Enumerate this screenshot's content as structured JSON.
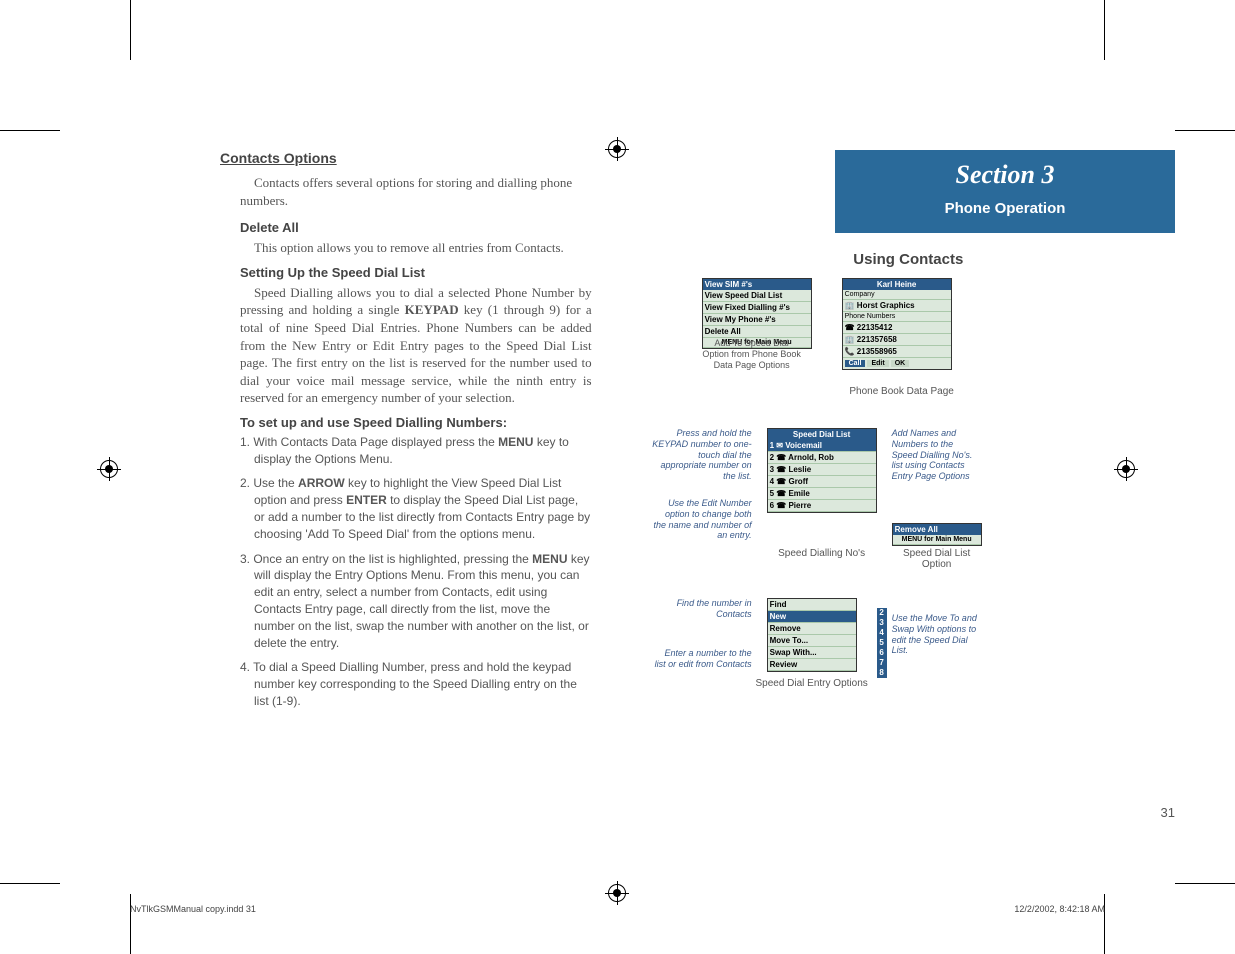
{
  "left": {
    "heading": "Contacts Options",
    "intro": "Contacts offers several options for storing and dialling phone numbers.",
    "delete_all_h": "Delete All",
    "delete_all_t": "This option allows you to remove all entries from Contacts.",
    "setup_h": "Setting Up the  Speed Dial List",
    "setup_t": "Speed Dialling allows you to dial a selected Phone Number by pressing and holding a single KEYPAD key (1 through 9) for a total of nine Speed Dial Entries. Phone Numbers can be added from the New Entry or Edit Entry pages to the Speed Dial List page.  The first entry on the list is reserved for the number used to dial your voice mail message service, while the ninth entry is reserved for an emergency number of your selection.",
    "use_h": "To set up and use Speed Dialling Numbers:",
    "steps": [
      "1. With Contacts Data Page displayed press the MENU key to display the Options Menu.",
      "2. Use the ARROW key to highlight the View Speed Dial List option and press ENTER to display the Speed Dial List page, or add a number to the list directly from Contacts Entry page by choosing 'Add To Speed Dial' from the options menu.",
      "3. Once an entry on the list is highlighted, pressing the MENU key will display the Entry Options Menu. From this menu, you can edit an entry, select a number from Contacts, edit using Contacts Entry page, call directly from the list, move the number on the list, swap the number with another on the list, or delete the entry.",
      "4. To dial a Speed Dialling Number, press and hold the keypad number key corresponding to the Speed Dialling entry on the list (1-9)."
    ]
  },
  "right": {
    "section_title": "Section 3",
    "section_sub": "Phone Operation",
    "using_heading": "Using Contacts",
    "fig1": {
      "left_menu_title": "View SIM #'s",
      "left_menu_items": [
        "View Speed Dial List",
        "View Fixed Dialling #'s",
        "View My Phone #'s",
        "Delete All"
      ],
      "left_menu_footer": "MENU for Main Menu",
      "left_caption": "Add To Speed Dial Option from Phone Book Data Page Options",
      "right_title": "Karl Heine",
      "right_company_label": "Company",
      "right_company": "Horst Graphics",
      "right_phone_label": "Phone Numbers",
      "right_numbers": [
        "22135412",
        "221357658",
        "213558965"
      ],
      "right_btns": [
        "Call",
        "Edit",
        "OK"
      ],
      "caption": "Phone Book Data Page"
    },
    "fig2": {
      "note_left_top": "Press and hold the KEYPAD number to one-touch dial the appropriate number on the list.",
      "note_left_bottom": "Use the Edit Number option to change both the name and number of an entry.",
      "note_right": "Add Names and Numbers to the Speed Dialling No's. list using Contacts Entry Page Options",
      "list_title": "Speed Dial List",
      "list_items": [
        "1 ✉ Voicemail",
        "2 ☎ Arnold, Rob",
        "3 ☎ Leslie",
        "4 ☎ Groff",
        "5 ☎ Emile",
        "6 ☎ Pierre"
      ],
      "caption_left": "Speed Dialling No's",
      "opt_title": "Remove All",
      "opt_footer": "MENU for Main Menu",
      "caption_right": "Speed Dial List Option"
    },
    "fig3": {
      "note_left_top": "Find the number in Contacts",
      "note_left_bottom": "Enter a number to the list or edit from Contacts",
      "note_right": "Use the Move To and Swap With options to  edit the Speed Dial List.",
      "menu_items": [
        "Find",
        "New",
        "Remove",
        "Move To...",
        "Swap With...",
        "Review"
      ],
      "caption": "Speed Dial Entry Options",
      "keypad": [
        "2",
        "3",
        "4",
        "5",
        "6",
        "7",
        "8"
      ]
    },
    "page_num": "31"
  },
  "footer": {
    "file": "NvTlkGSMManual copy.indd   31",
    "timestamp": "12/2/2002, 8:42:18 AM"
  }
}
